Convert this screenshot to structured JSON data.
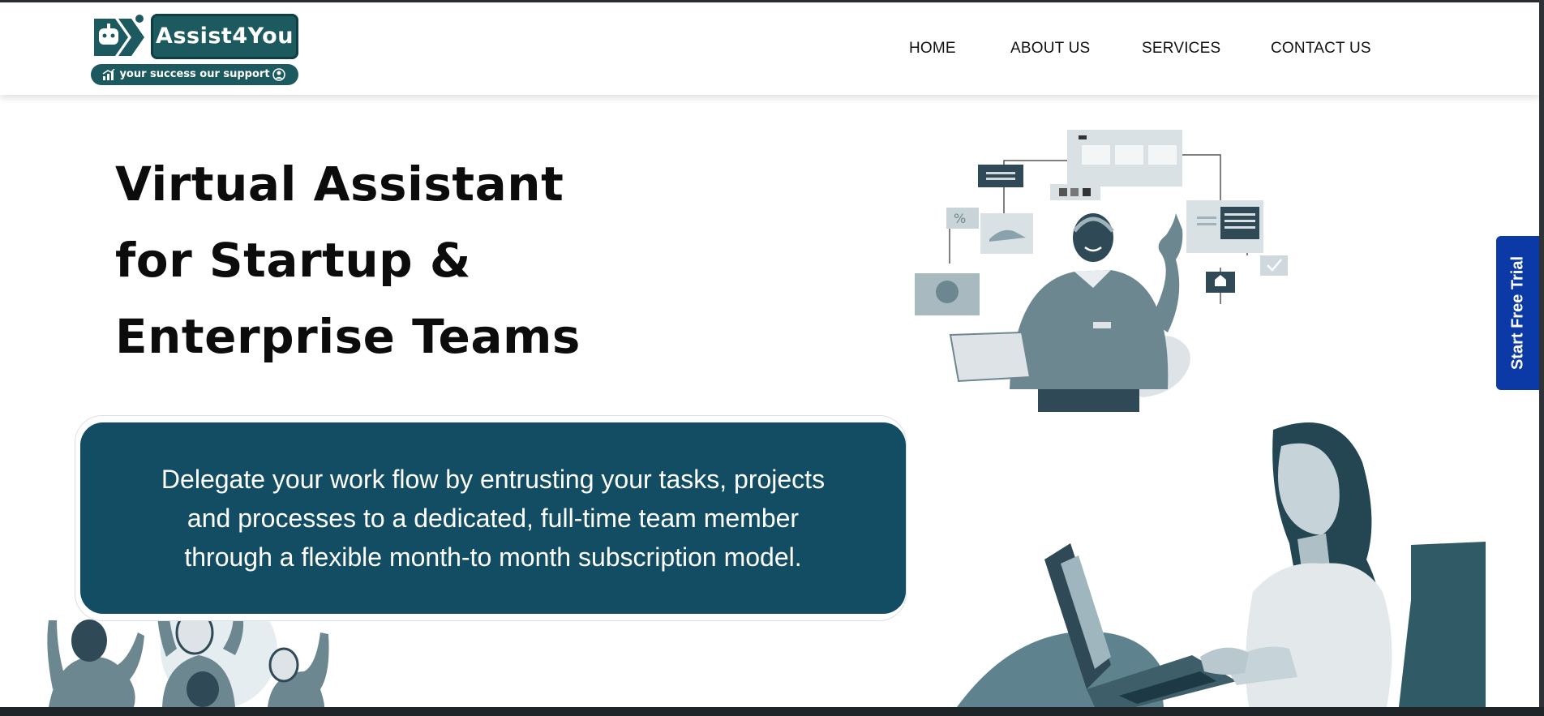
{
  "brand": {
    "name": "Assist4You",
    "tagline": "your success our support"
  },
  "nav": {
    "items": [
      {
        "label": "HOME"
      },
      {
        "label": "ABOUT US"
      },
      {
        "label": "SERVICES"
      },
      {
        "label": "CONTACT US"
      }
    ]
  },
  "hero": {
    "headline_lines": [
      "Virtual Assistant",
      "for Startup &",
      "Enterprise Teams"
    ],
    "description_lines": [
      "Delegate your work flow by entrusting your tasks, projects",
      "and processes to a dedicated, full-time team member",
      "through a flexible month-to month subscription model."
    ]
  },
  "cta": {
    "trial_label": "Start Free Trial"
  },
  "colors": {
    "brand_teal": "#1d5a60",
    "hero_box": "#134d64",
    "cta_blue": "#0b3aa7",
    "illustration_tone": "#4f7a86"
  },
  "icons": [
    "robot-chevron-logo-icon",
    "growth-chart-icon",
    "support-agent-icon"
  ]
}
